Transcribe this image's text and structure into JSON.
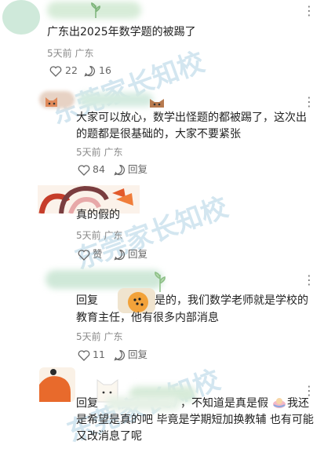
{
  "watermark": "东莞家长知校",
  "more_glyph": "⋮",
  "comments": [
    {
      "text": "广东出2025年数学题的被踢了",
      "meta": "5天前 广东",
      "likes": "22",
      "replies": "16"
    },
    {
      "text_line1": "大家可以放心，数学出怪题的都被踢了，这次出",
      "text_line2": "的题都是很基础的，大家不要紧张",
      "meta": "5天前 广东",
      "likes": "84",
      "reply_label": "回复"
    },
    {
      "text": "真的假的",
      "meta": "5天前 广东",
      "like_label": "赞",
      "reply_label": "回复"
    },
    {
      "prefix": "回复",
      "text_line1": "是的，我们数学老师就是学校的",
      "text_line2": "教育主任，他有很多内部消息",
      "meta": "5天前 广东",
      "likes": "11",
      "reply_label": "回复"
    },
    {
      "prefix": "回复",
      "text_line1a": "，不知道是真是假",
      "text_line1b": "我还",
      "text_line2": "是希望是真的吧 毕竟是学期短加换教辅 也有可能",
      "text_line3": "又改消息了呢"
    }
  ]
}
